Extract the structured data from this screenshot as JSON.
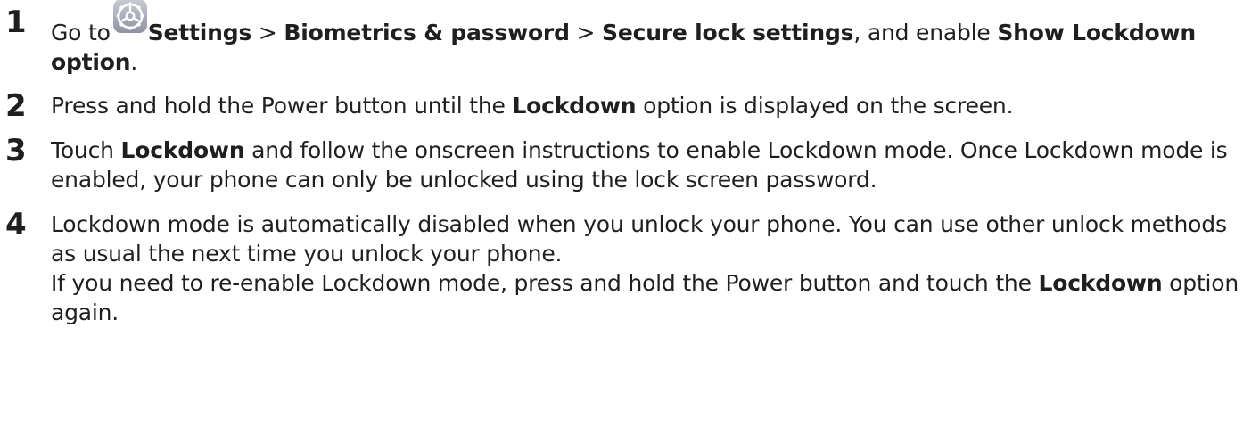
{
  "steps": [
    {
      "number": "1",
      "go_to": "Go to",
      "settings": "Settings",
      "sep1": " > ",
      "biometrics": "Biometrics & password",
      "sep2": " > ",
      "secure_lock": "Secure lock settings",
      "and_enable": ", and enable ",
      "show_lockdown": "Show Lockdown option",
      "end": "."
    },
    {
      "number": "2",
      "text_a": "Press and hold the Power button until the ",
      "lockdown": "Lockdown",
      "text_b": " option is displayed on the screen."
    },
    {
      "number": "3",
      "touch": "Touch ",
      "lockdown": "Lockdown",
      "text_b": " and follow the onscreen instructions to enable Lockdown mode. Once Lockdown mode is enabled, your phone can only be unlocked using the lock screen password."
    },
    {
      "number": "4",
      "para1": "Lockdown mode is automatically disabled when you unlock your phone. You can use other unlock methods as usual the next time you unlock your phone.",
      "para2_a": "If you need to re-enable Lockdown mode, press and hold the Power button and touch the ",
      "lockdown": "Lockdown",
      "para2_b": " option again."
    }
  ],
  "icons": {
    "settings_icon": "settings-gear-icon",
    "settings_icon_color": "#8a8a9a"
  }
}
